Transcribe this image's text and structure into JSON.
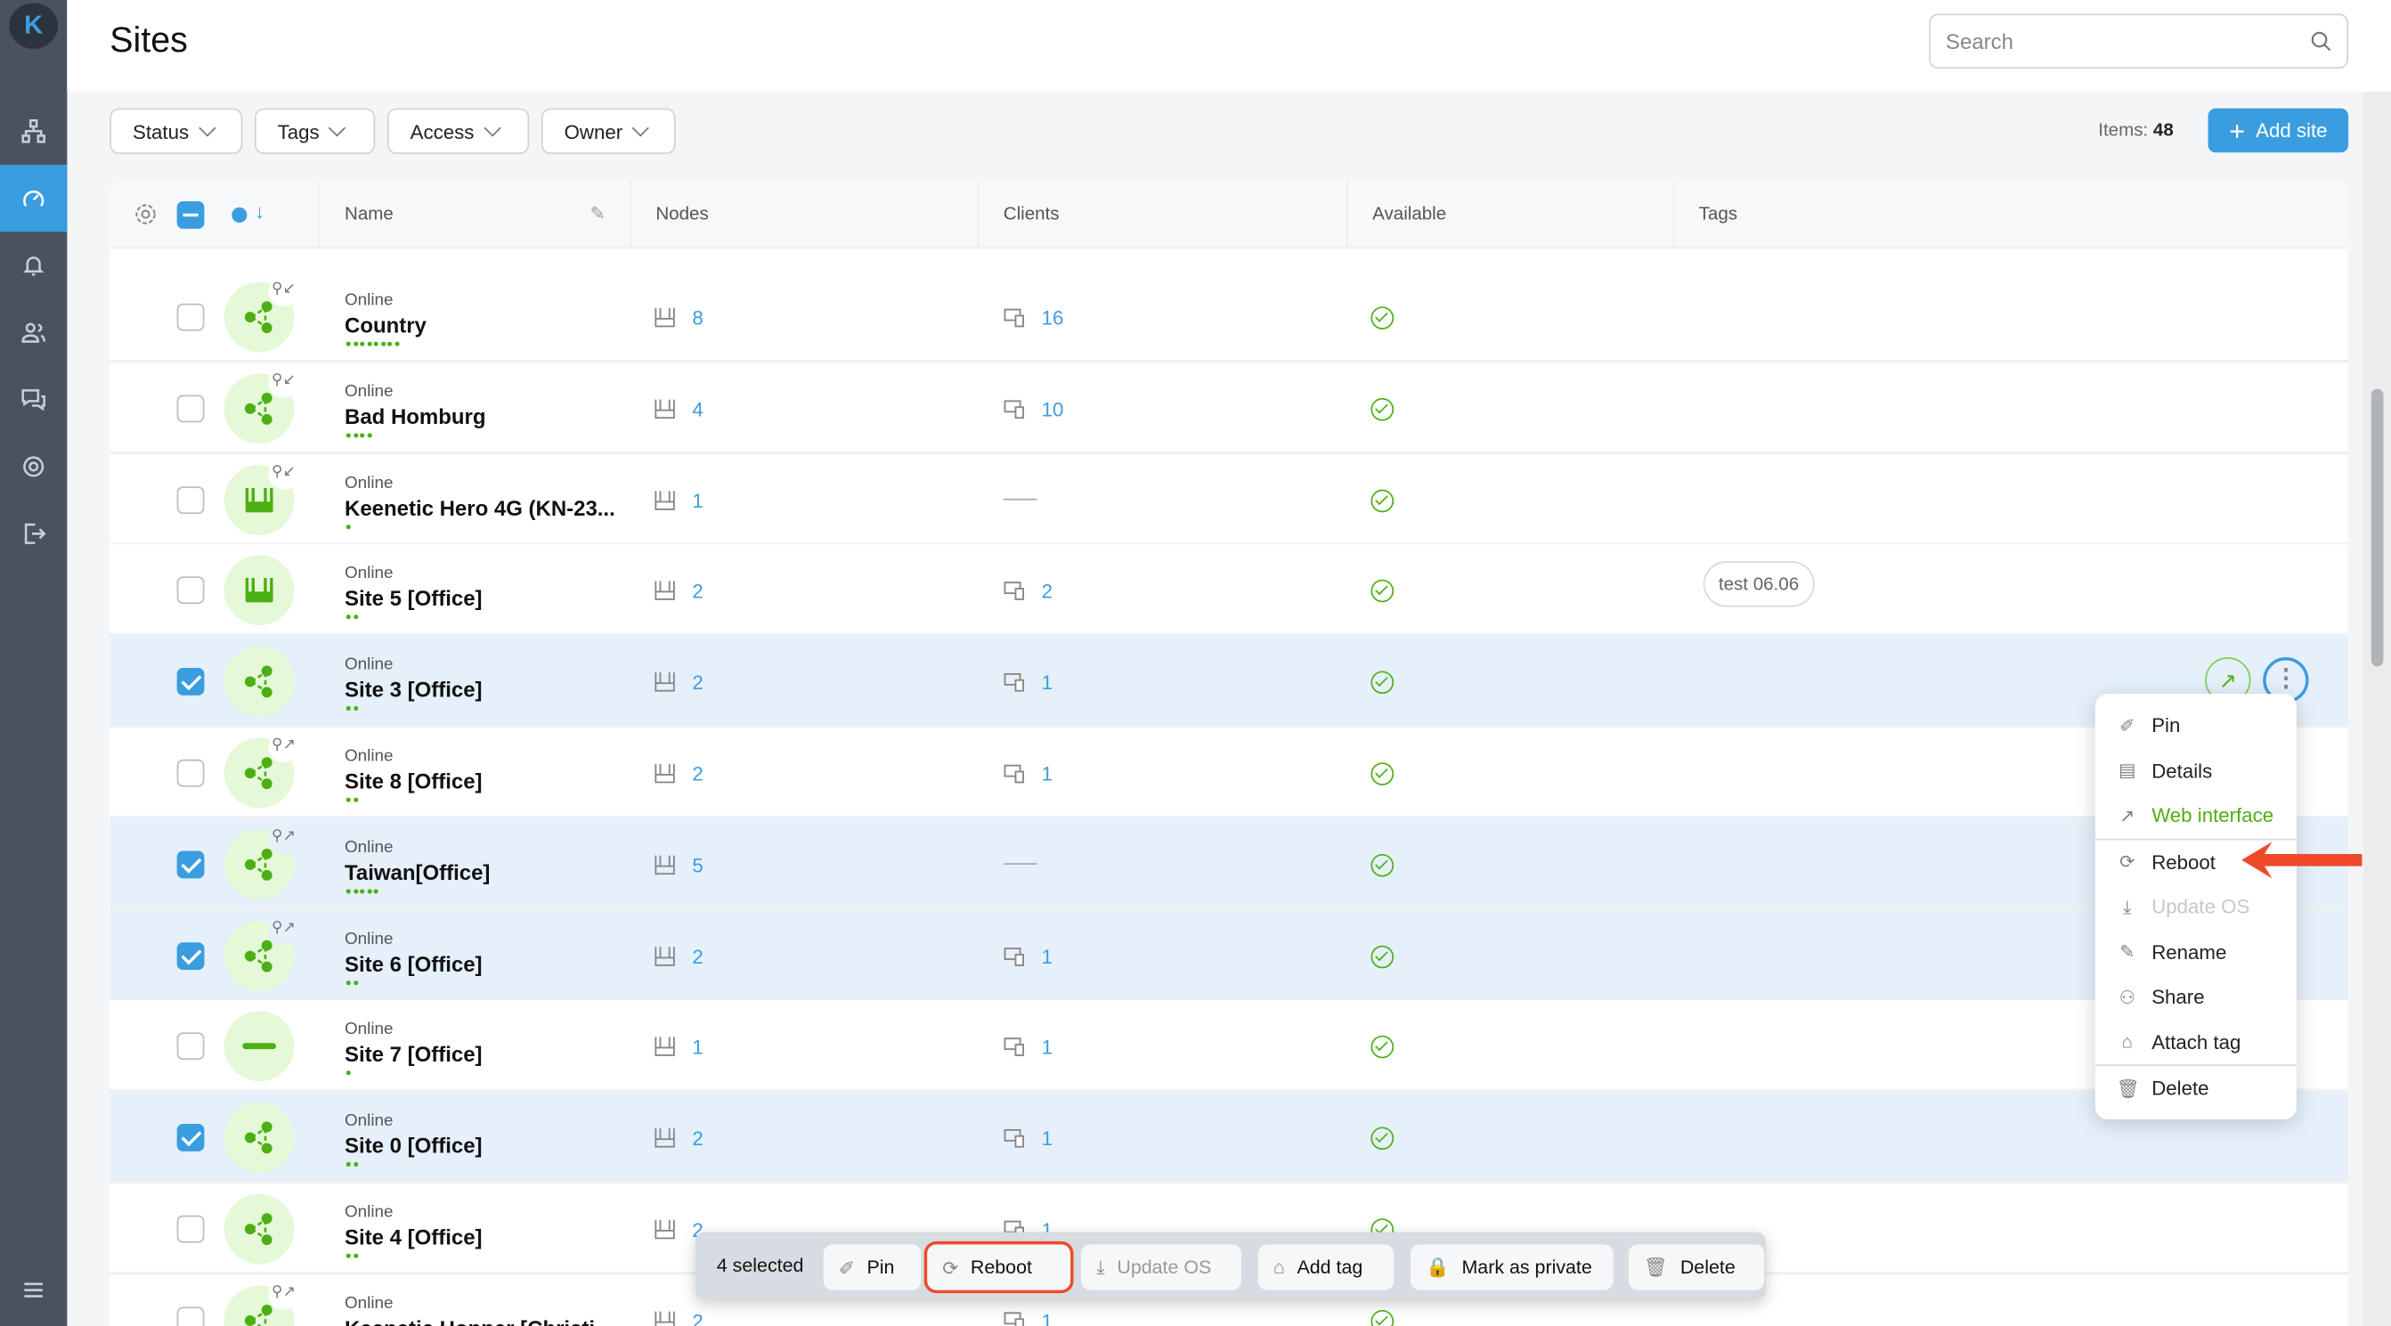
{
  "app": {
    "logo": "K",
    "title": "Sites"
  },
  "sidebar": {
    "items": [
      {
        "icon": "network-icon"
      },
      {
        "icon": "dashboard-icon",
        "active": true
      },
      {
        "icon": "bell-icon"
      },
      {
        "icon": "users-icon"
      },
      {
        "icon": "chat-icon"
      },
      {
        "icon": "gear-icon"
      },
      {
        "icon": "logout-icon"
      },
      {
        "icon": "menu-icon"
      }
    ]
  },
  "search": {
    "placeholder": "Search"
  },
  "filters": [
    "Status",
    "Tags",
    "Access",
    "Owner"
  ],
  "items_label": "Items:",
  "items_count": "48",
  "add_site": "Add site",
  "table": {
    "columns": {
      "name": "Name",
      "nodes": "Nodes",
      "clients": "Clients",
      "available": "Available",
      "tags": "Tags"
    },
    "rows": [
      {
        "status": "Online",
        "name": "Country",
        "dots": 8,
        "nodes": "8",
        "clients": "16",
        "icon": "network",
        "shared": "in",
        "selected": false
      },
      {
        "status": "Online",
        "name": "Bad Homburg",
        "dots": 4,
        "nodes": "4",
        "clients": "10",
        "icon": "network",
        "shared": "in",
        "selected": false
      },
      {
        "status": "Online",
        "name": "Keenetic Hero 4G (KN-23...",
        "dots": 1,
        "nodes": "1",
        "clients": null,
        "icon": "router",
        "shared": "in",
        "selected": false
      },
      {
        "status": "Online",
        "name": "Site 5 [Office]",
        "dots": 2,
        "nodes": "2",
        "clients": "2",
        "icon": "router",
        "shared": null,
        "selected": false,
        "tag": "test 06.06"
      },
      {
        "status": "Online",
        "name": "Site 3 [Office]",
        "dots": 2,
        "nodes": "2",
        "clients": "1",
        "icon": "network",
        "shared": null,
        "selected": true,
        "actions": true
      },
      {
        "status": "Online",
        "name": "Site 8 [Office]",
        "dots": 2,
        "nodes": "2",
        "clients": "1",
        "icon": "network",
        "shared": "out",
        "selected": false
      },
      {
        "status": "Online",
        "name": "Taiwan[Office]",
        "dots": 5,
        "nodes": "5",
        "clients": null,
        "icon": "network",
        "shared": "out",
        "selected": true
      },
      {
        "status": "Online",
        "name": "Site 6 [Office]",
        "dots": 2,
        "nodes": "2",
        "clients": "1",
        "icon": "network",
        "shared": "out",
        "selected": true
      },
      {
        "status": "Online",
        "name": "Site 7 [Office]",
        "dots": 1,
        "nodes": "1",
        "clients": "1",
        "icon": "device",
        "shared": null,
        "selected": false
      },
      {
        "status": "Online",
        "name": "Site 0 [Office]",
        "dots": 2,
        "nodes": "2",
        "clients": "1",
        "icon": "network",
        "shared": null,
        "selected": true
      },
      {
        "status": "Online",
        "name": "Site 4 [Office]",
        "dots": 2,
        "nodes": "2",
        "clients": "1",
        "icon": "network",
        "shared": null,
        "selected": false
      },
      {
        "status": "Online",
        "name": "Keenetic Hopper [Christi...",
        "dots": 0,
        "nodes": "2",
        "clients": "1",
        "icon": "network",
        "shared": "out",
        "selected": false
      }
    ]
  },
  "context_menu": {
    "items": [
      {
        "label": "Pin",
        "icon": "pin-icon"
      },
      {
        "label": "Details",
        "icon": "details-icon"
      },
      {
        "label": "Web interface",
        "icon": "external-link-icon",
        "green": true,
        "sep": true
      },
      {
        "label": "Reboot",
        "icon": "reboot-icon"
      },
      {
        "label": "Update OS",
        "icon": "download-icon",
        "disabled": true
      },
      {
        "label": "Rename",
        "icon": "pencil-icon"
      },
      {
        "label": "Share",
        "icon": "users-icon"
      },
      {
        "label": "Attach tag",
        "icon": "tag-icon",
        "sep": true
      },
      {
        "label": "Delete",
        "icon": "trash-icon"
      }
    ]
  },
  "bulk": {
    "selected": "4 selected",
    "buttons": [
      {
        "label": "Pin",
        "icon": "pin-icon"
      },
      {
        "label": "Reboot",
        "icon": "reboot-icon",
        "highlight": true
      },
      {
        "label": "Update OS",
        "icon": "download-icon",
        "disabled": true
      },
      {
        "label": "Add tag",
        "icon": "tag-icon"
      },
      {
        "label": "Mark as private",
        "icon": "lock-icon"
      },
      {
        "label": "Delete",
        "icon": "trash-icon"
      }
    ]
  },
  "colors": {
    "accent": "#3a9de0",
    "online": "#4caf14",
    "annotation": "#ee4a2a",
    "selected_row": "#e5f0fb"
  }
}
